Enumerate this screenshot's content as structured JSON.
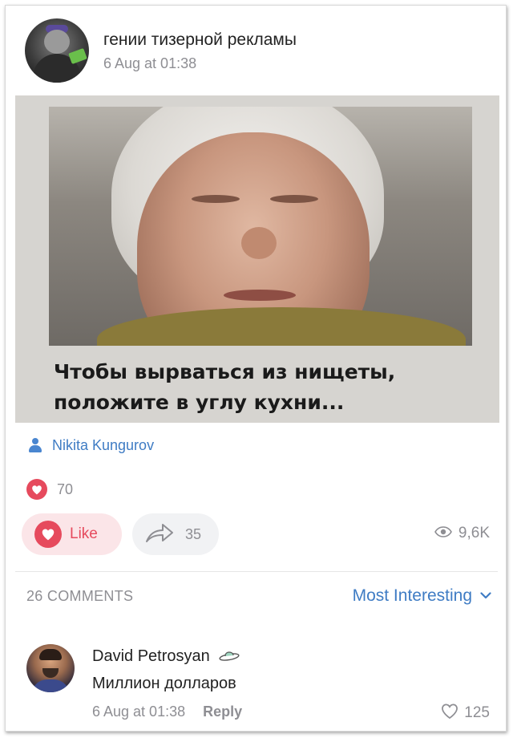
{
  "post": {
    "group_name": "гении тизерной рекламы",
    "time": "6 Aug at 01:38",
    "image_caption_line1": "Чтобы вырваться из нищеты,",
    "image_caption_line2": "положите в углу кухни...",
    "author": "Nikita Kungurov",
    "likes_count": "70",
    "like_label": "Like",
    "shares_count": "35",
    "views_count": "9,6K"
  },
  "comments_section": {
    "count_label": "26 COMMENTS",
    "sort_label": "Most Interesting"
  },
  "comment": {
    "author": "David Petrosyan",
    "text": "Миллион долларов",
    "time": "6 Aug at 01:38",
    "reply_label": "Reply",
    "likes": "125"
  },
  "colors": {
    "accent_blue": "#3f7cc4",
    "like_red": "#e64a5d",
    "muted_gray": "#8e8e93"
  }
}
